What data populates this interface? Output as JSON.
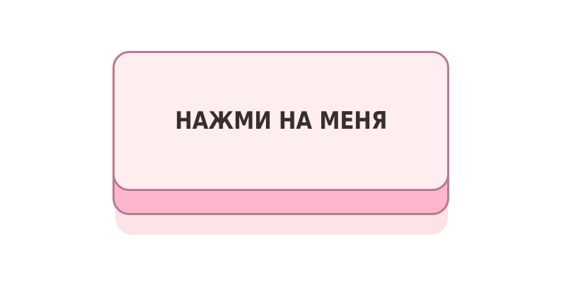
{
  "button": {
    "label": "НАЖМИ НА МЕНЯ"
  },
  "colors": {
    "face": "#ffeeef",
    "base": "#ffb6cc",
    "border": "#b97a92",
    "glow": "#fde2e6",
    "text": "#3a2e2a"
  }
}
